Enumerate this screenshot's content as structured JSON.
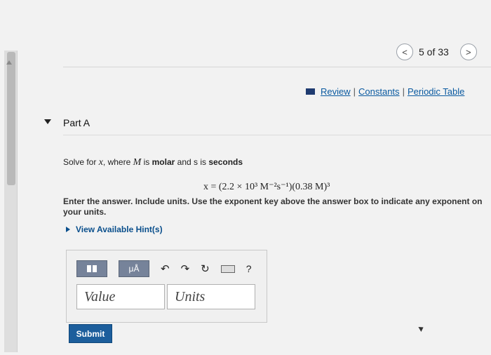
{
  "pager": {
    "prev_symbol": "<",
    "position_text": "5 of 33",
    "next_symbol": ">"
  },
  "links": {
    "review": "Review",
    "constants": "Constants",
    "periodic_table": "Periodic Table",
    "separator": "|"
  },
  "part": {
    "title": "Part A"
  },
  "question": {
    "prompt_prefix": "Solve for ",
    "var_x": "x",
    "prompt_mid": ", where ",
    "var_M": "M",
    "prompt_is": " is ",
    "molar": "molar",
    "prompt_and": " and s is ",
    "seconds": "seconds",
    "equation": "x = (2.2 × 10³ M⁻²s⁻¹)(0.38 M)³",
    "instruction": "Enter the answer. Include units. Use the exponent key above the answer box to indicate any exponent on your units."
  },
  "hints": {
    "label": "View Available Hint(s)"
  },
  "toolbar": {
    "units_btn": "μÅ",
    "undo": "↶",
    "redo": "↷",
    "reset": "↻",
    "help": "?"
  },
  "answer": {
    "value_placeholder": "Value",
    "units_placeholder": "Units"
  },
  "submit": {
    "label": "Submit"
  },
  "colors": {
    "link": "#0a5aa0",
    "submit_bg": "#1c5e9c",
    "toolbar_btn": "#76839a"
  }
}
